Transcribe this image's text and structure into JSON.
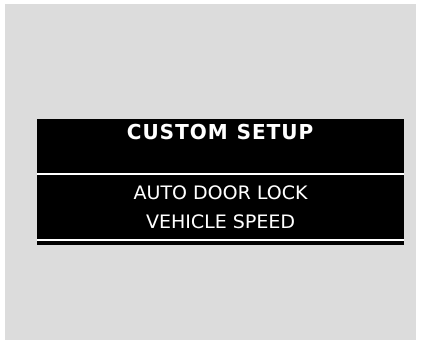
{
  "screen": {
    "title": "CUSTOM SETUP",
    "menu_items": [
      {
        "label": "AUTO DOOR LOCK"
      },
      {
        "label": "VEHICLE  SPEED"
      }
    ]
  },
  "colors": {
    "frame_background": "#dcdcdc",
    "display_background": "#000000",
    "display_text": "#ffffff"
  }
}
